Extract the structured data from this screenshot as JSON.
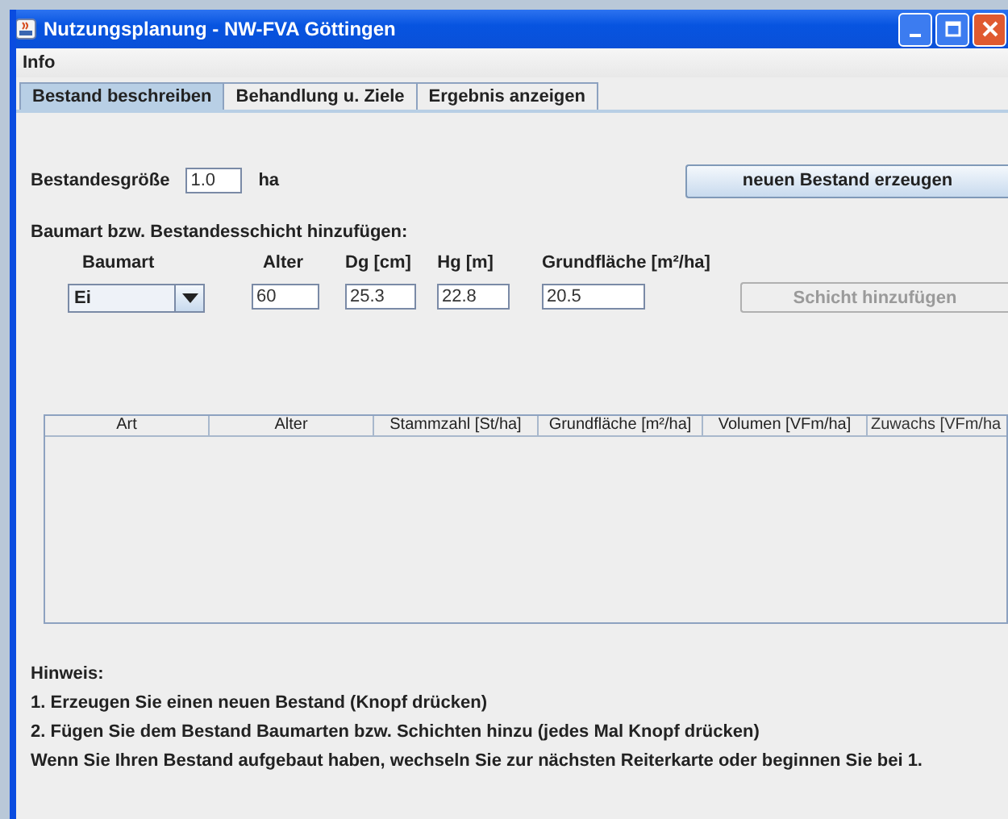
{
  "window": {
    "title": "Nutzungsplanung - NW-FVA Göttingen"
  },
  "menu": [
    "Info"
  ],
  "tabs": [
    {
      "label": "Bestand beschreiben",
      "selected": true
    },
    {
      "label": "Behandlung u. Ziele",
      "selected": false
    },
    {
      "label": "Ergebnis anzeigen",
      "selected": false
    }
  ],
  "stand_size": {
    "label": "Bestandesgröße",
    "value": "1.0",
    "unit": "ha"
  },
  "create_button": {
    "label": "neuen Bestand erzeugen",
    "disabled": false
  },
  "layer_section": {
    "title": "Baumart bzw. Bestandesschicht hinzufügen:",
    "fields": [
      {
        "label": "Baumart",
        "value": "Ei",
        "kind": "combo"
      },
      {
        "label": "Alter",
        "value": "60",
        "kind": "text"
      },
      {
        "label": "Dg [cm]",
        "value": "25.3",
        "kind": "text"
      },
      {
        "label": "Hg [m]",
        "value": "22.8",
        "kind": "text"
      },
      {
        "label": "Grundfläche [m²/ha]",
        "value": "20.5",
        "kind": "text"
      }
    ],
    "add_button": {
      "label": "Schicht hinzufügen",
      "disabled": true
    }
  },
  "table": {
    "columns": [
      "Art",
      "Alter",
      "Stammzahl [St/ha]",
      "Grundfläche [m²/ha]",
      "Volumen [VFm/ha]",
      "Zuwachs [VFm/ha"
    ]
  },
  "hint": {
    "title": "Hinweis:",
    "lines": [
      "1. Erzeugen Sie einen neuen Bestand (Knopf drücken)",
      "2. Fügen Sie dem Bestand Baumarten bzw. Schichten hinzu (jedes Mal Knopf drücken)",
      "Wenn Sie Ihren Bestand aufgebaut haben, wechseln Sie zur nächsten Reiterkarte oder beginnen Sie bei 1."
    ]
  }
}
